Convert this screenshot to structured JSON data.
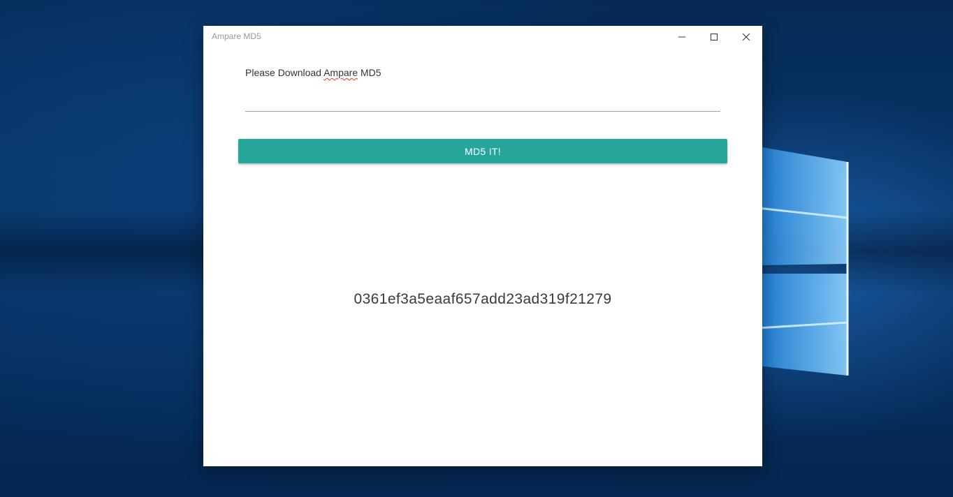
{
  "window": {
    "title": "Ampare MD5",
    "controls": {
      "minimize_icon": "minimize-icon",
      "maximize_icon": "maximize-icon",
      "close_icon": "close-icon"
    }
  },
  "form": {
    "label_prefix": "Please Download ",
    "label_misspelled": "Ampare",
    "label_suffix": " MD5",
    "input_value": "",
    "button_label": "MD5 IT!"
  },
  "result": {
    "hash": "0361ef3a5eaaf657add23ad319f21279"
  },
  "colors": {
    "button_bg": "#26a69a",
    "button_text": "#ffffff",
    "window_bg": "#ffffff",
    "desktop_accent": "#0a3e78"
  }
}
